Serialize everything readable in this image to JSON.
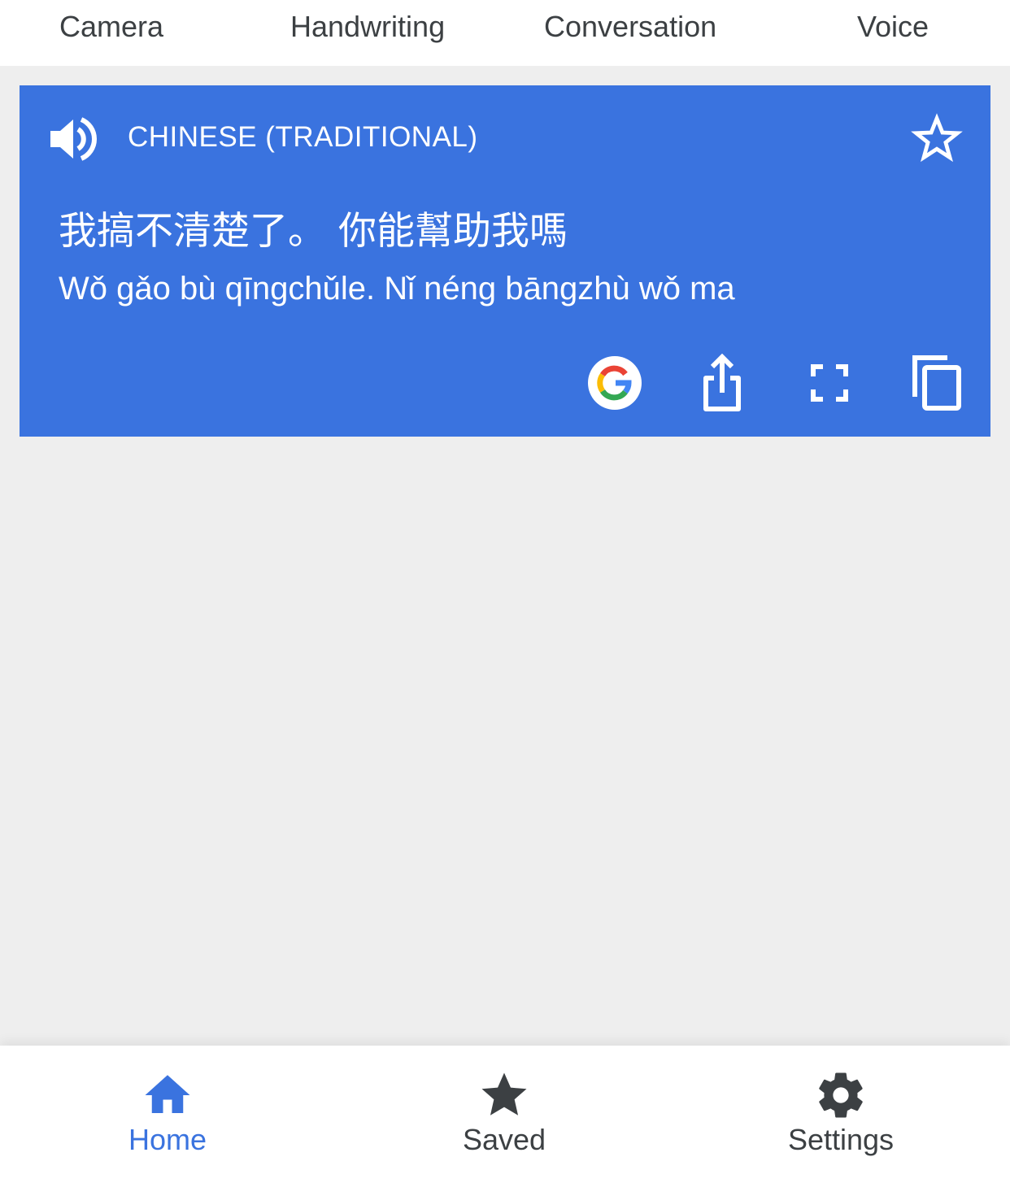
{
  "top_tabs": [
    {
      "label": "Camera"
    },
    {
      "label": "Handwriting"
    },
    {
      "label": "Conversation"
    },
    {
      "label": "Voice"
    }
  ],
  "card": {
    "language": "CHINESE (TRADITIONAL)",
    "source_text": "我搞不清楚了。 你能幫助我嗎",
    "romanization": "Wǒ gǎo bù qīngchǔle. Nǐ néng bāngzhù wǒ ma",
    "icons": {
      "speaker": "volume-up-icon",
      "star": "star-outline-icon",
      "google": "google-logo-icon",
      "share": "share-icon",
      "fullscreen": "fullscreen-icon",
      "copy": "copy-icon"
    },
    "background_color": "#3a73df"
  },
  "bottom_nav": {
    "items": [
      {
        "label": "Home",
        "icon": "home-icon",
        "active": true
      },
      {
        "label": "Saved",
        "icon": "star-icon",
        "active": false
      },
      {
        "label": "Settings",
        "icon": "gear-icon",
        "active": false
      }
    ],
    "active_color": "#3a73df",
    "inactive_color": "#3c4043"
  }
}
